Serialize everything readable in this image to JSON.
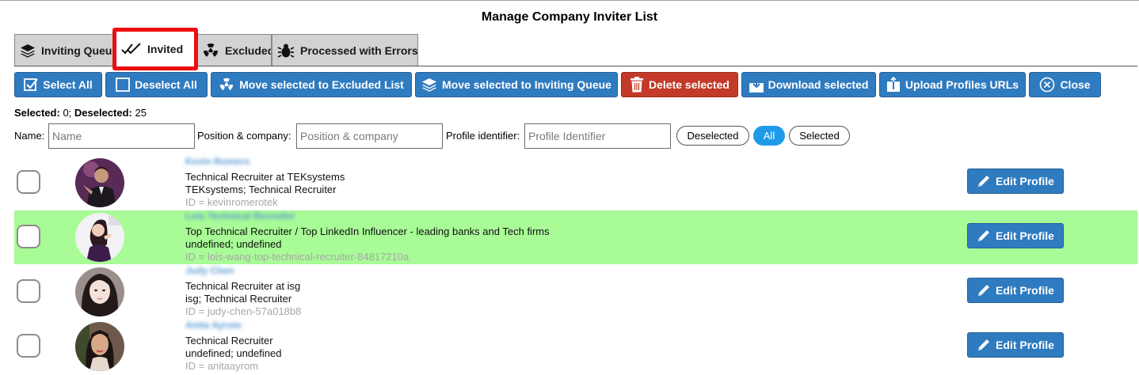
{
  "title": "Manage Company Inviter List",
  "tabs": [
    {
      "label": "Inviting Queue",
      "icon": "layers-icon"
    },
    {
      "label": "Invited",
      "icon": "double-check-icon",
      "active": true
    },
    {
      "label": "Excluded",
      "icon": "radiation-icon"
    },
    {
      "label": "Processed with Errors",
      "icon": "bug-icon"
    }
  ],
  "toolbar": {
    "select_all": "Select All",
    "deselect_all": "Deselect All",
    "move_excluded": "Move selected to Excluded List",
    "move_queue": "Move selected to Inviting Queue",
    "delete": "Delete selected",
    "download": "Download selected",
    "upload": "Upload Profiles URLs",
    "close": "Close",
    "delete_color": "#c33a28",
    "accent_color": "#2f7bc0"
  },
  "counts": {
    "selected_label": "Selected:",
    "selected_value": "0;",
    "deselected_label": "Deselected:",
    "deselected_value": "25"
  },
  "filters": {
    "name_label": "Name:",
    "name_placeholder": "Name",
    "position_label": "Position & company:",
    "position_placeholder": "Position & company",
    "profile_label": "Profile identifier:",
    "profile_placeholder": "Profile Identifier",
    "options": [
      "Deselected",
      "All",
      "Selected"
    ],
    "active_option": "All"
  },
  "rows": [
    {
      "name": "Kevin Romero",
      "headline": "Technical Recruiter at TEKsystems",
      "company_position": "TEKsystems; Technical Recruiter",
      "id": "ID = kevinromerotek",
      "edit_label": "Edit Profile",
      "highlighted": false
    },
    {
      "name": "Lois Technical Recruiter",
      "headline": "Top Technical Recruiter / Top LinkedIn Influencer - leading banks and Tech firms",
      "company_position": "undefined; undefined",
      "id": "ID = lois-wang-top-technical-recruiter-84817210a",
      "edit_label": "Edit Profile",
      "highlighted": true,
      "highlight_color": "#a8fb96"
    },
    {
      "name": "Judy Chen",
      "headline": "Technical Recruiter at isg",
      "company_position": "isg; Technical Recruiter",
      "id": "ID = judy-chen-57a018b8",
      "edit_label": "Edit Profile",
      "highlighted": false
    },
    {
      "name": "Anita Ayrom",
      "headline": "Technical Recruiter",
      "company_position": "undefined; undefined",
      "id": "ID = anitaayrom",
      "edit_label": "Edit Profile",
      "highlighted": false
    }
  ]
}
